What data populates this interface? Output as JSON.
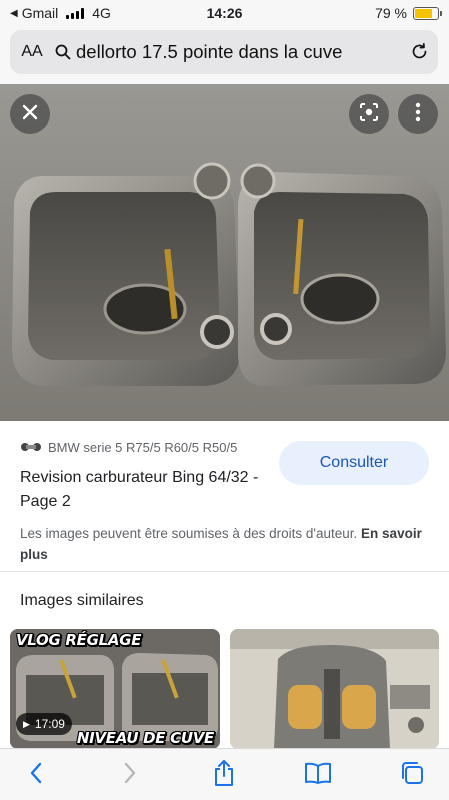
{
  "status": {
    "carrier": "Gmail",
    "network": "4G",
    "time": "14:26",
    "battery": "79 %",
    "battery_level": 0.79
  },
  "address_bar": {
    "text_size_label": "AA",
    "query": "dellorto 17.5 pointe dans la cuve"
  },
  "viewer": {
    "close_icon": "close-icon",
    "lens_icon": "lens-icon",
    "more_icon": "more-vertical-icon"
  },
  "result": {
    "source": "BMW serie 5 R75/5 R60/5 R50/5",
    "title": "Revision carburateur Bing 64/32 - Page 2",
    "consult_label": "Consulter",
    "rights_text": "Les images peuvent être soumises à des droits d'auteur.",
    "rights_link": "En savoir plus"
  },
  "similar": {
    "heading": "Images similaires",
    "items": [
      {
        "overlay_top": "VLOG RÉGLAGE",
        "overlay_bottom": "NIVEAU DE CUVE",
        "duration": "17:09"
      },
      {}
    ]
  },
  "toolbar": {
    "icons": [
      "back-icon",
      "forward-icon",
      "share-icon",
      "bookmarks-icon",
      "tabs-icon"
    ]
  },
  "colors": {
    "accent": "#1a56b5",
    "button_bg": "#e8f0fe",
    "battery": "#f5c400"
  }
}
